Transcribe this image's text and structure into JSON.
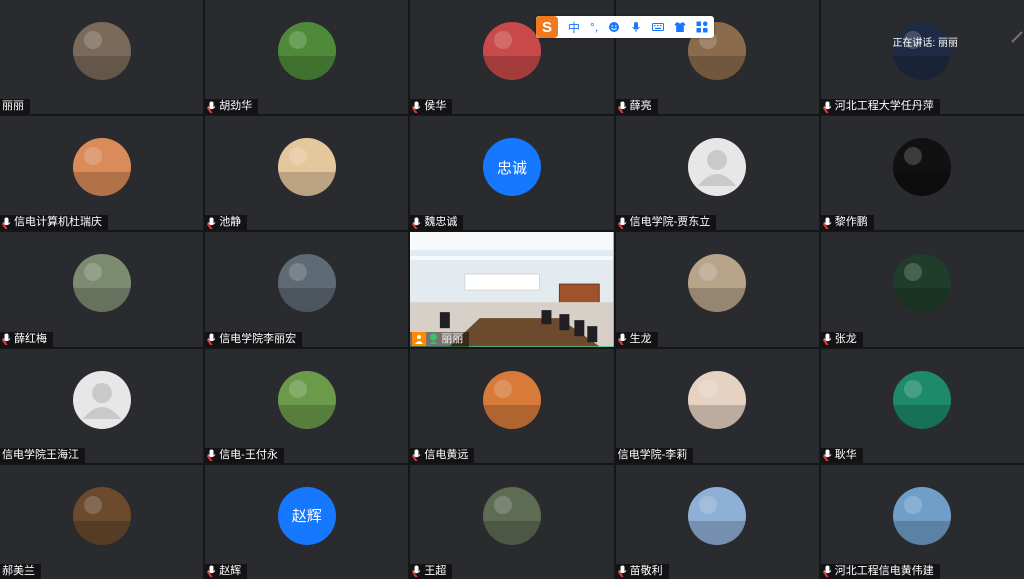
{
  "speaker_banner": "正在讲话: 丽丽",
  "toolbar": {
    "logo": "S",
    "items": [
      "中",
      "°,",
      "emoji-icon",
      "mic-icon",
      "keyboard-icon",
      "shirt-icon",
      "grid-icon"
    ]
  },
  "participants": [
    {
      "name": "丽丽",
      "avatar": "photo",
      "mic": false,
      "color": "#7a6a5a"
    },
    {
      "name": "胡劲华",
      "avatar": "photo",
      "mic": true,
      "color": "#4f8a3a"
    },
    {
      "name": "侯华",
      "avatar": "photo",
      "mic": true,
      "color": "#c94a4a"
    },
    {
      "name": "薛亮",
      "avatar": "photo",
      "mic": true,
      "color": "#8a6b4b"
    },
    {
      "name": "河北工程大学任丹萍",
      "avatar": "photo",
      "mic": true,
      "color": "#1f2a44"
    },
    {
      "name": "信电计算机杜瑞庆",
      "avatar": "photo",
      "mic": true,
      "color": "#d98b5a"
    },
    {
      "name": "池静",
      "avatar": "photo",
      "mic": true,
      "color": "#e5c79e"
    },
    {
      "name": "魏忠诚",
      "avatar": "initial",
      "initial": "忠诚",
      "mic": true
    },
    {
      "name": "信电学院-贾东立",
      "avatar": "default",
      "mic": true
    },
    {
      "name": "黎作鹏",
      "avatar": "photo",
      "mic": true,
      "color": "#111111"
    },
    {
      "name": "薛红梅",
      "avatar": "photo",
      "mic": true,
      "color": "#7d8c70"
    },
    {
      "name": "信电学院李丽宏",
      "avatar": "photo",
      "mic": true,
      "color": "#5e6a74"
    },
    {
      "name": "丽丽",
      "avatar": "video",
      "mic": true,
      "active": true
    },
    {
      "name": "生龙",
      "avatar": "photo",
      "mic": true,
      "color": "#b7a48a"
    },
    {
      "name": "张龙",
      "avatar": "photo",
      "mic": true,
      "color": "#1f3d2a"
    },
    {
      "name": "信电学院王海江",
      "avatar": "default",
      "mic": false
    },
    {
      "name": "信电-王付永",
      "avatar": "photo",
      "mic": true,
      "color": "#6b9a4a"
    },
    {
      "name": "信电黄远",
      "avatar": "photo",
      "mic": true,
      "color": "#d77a3a"
    },
    {
      "name": "信电学院-李莉",
      "avatar": "photo",
      "mic": false,
      "color": "#e6d2c3"
    },
    {
      "name": "耿华",
      "avatar": "photo",
      "mic": true,
      "color": "#1d8a68"
    },
    {
      "name": "郝美兰",
      "avatar": "photo",
      "mic": false,
      "color": "#6b4a2e"
    },
    {
      "name": "赵辉",
      "avatar": "initial",
      "initial": "赵辉",
      "mic": true
    },
    {
      "name": "王超",
      "avatar": "photo",
      "mic": true,
      "color": "#5e6c54"
    },
    {
      "name": "苗敬利",
      "avatar": "photo",
      "mic": true,
      "color": "#8fb0d6"
    },
    {
      "name": "河北工程信电黄伟建",
      "avatar": "photo",
      "mic": true,
      "color": "#6f9fc8"
    }
  ]
}
